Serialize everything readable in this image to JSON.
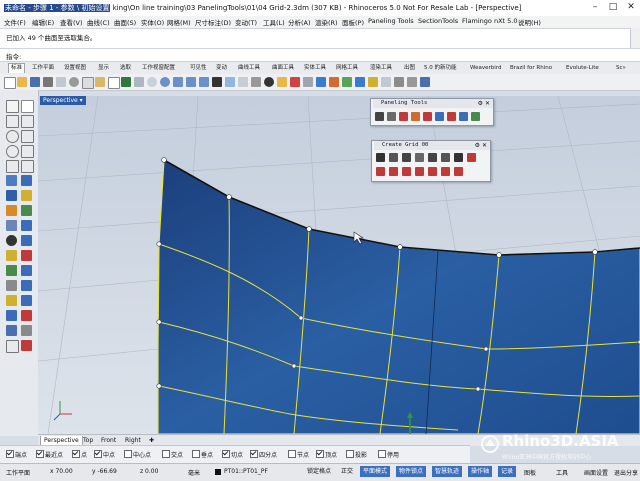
{
  "titlebar": {
    "text_highlight": "未命名 - 步骤 1 - 参数 \\ 初始设置",
    "text": "king\\On line training\\03 PanelingTools\\01\\04 Grid-2.3dm (307 KB) - Rhinoceros 5.0 Not For Resale Lab - [Perspective]"
  },
  "menu": [
    "文件(F)",
    "编辑(E)",
    "查看(V)",
    "曲线(C)",
    "曲面(S)",
    "实体(O)",
    "网格(M)",
    "尺寸标注(D)",
    "变动(T)",
    "工具(L)",
    "分析(A)",
    "渲染(R)",
    "面板(P)",
    "Paneling Tools",
    "SectionTools",
    "Flamingo nXt 5.0",
    "说明(H)"
  ],
  "command": {
    "history": "已加入 49 个曲面至选取集合。",
    "prompt_label": "指令:"
  },
  "toolbar_tabs": [
    "标准",
    "工作平面",
    "设置视图",
    "显示",
    "选取",
    "工作视窗配置",
    "可见性",
    "变动",
    "曲线工具",
    "曲面工具",
    "实体工具",
    "网格工具",
    "渲染工具",
    "出图",
    "5.0 的新功能",
    "Weaverbird",
    "Brazil for Rhino",
    "Evolute-Lite",
    "Sc»"
  ],
  "viewport": {
    "label": "Perspective"
  },
  "panels": {
    "paneling_tools": {
      "title": "Paneling Tools"
    },
    "create_grid": {
      "title": "Create Grid 00"
    }
  },
  "viewport_tabs": [
    "Perspective",
    "Top",
    "Front",
    "Right"
  ],
  "osnaps": [
    {
      "label": "端点",
      "checked": true
    },
    {
      "label": "最近点",
      "checked": true
    },
    {
      "label": "点",
      "checked": true
    },
    {
      "label": "中点",
      "checked": true
    },
    {
      "label": "中心点",
      "checked": false
    },
    {
      "label": "交点",
      "checked": false
    },
    {
      "label": "垂点",
      "checked": false
    },
    {
      "label": "切点",
      "checked": true
    },
    {
      "label": "四分点",
      "checked": true
    },
    {
      "label": "节点",
      "checked": false
    },
    {
      "label": "顶点",
      "checked": true
    },
    {
      "label": "投影",
      "checked": false
    },
    {
      "label": "停用",
      "checked": false
    }
  ],
  "status": {
    "cplane": "工作平面",
    "x": "x 70.00",
    "y": "y -66.69",
    "z": "z 0.00",
    "unit": "毫米",
    "layer": "PT01::PT01_PF",
    "buttons": [
      {
        "label": "锁定格点",
        "on": false
      },
      {
        "label": "正交",
        "on": false
      },
      {
        "label": "平面模式",
        "on": true
      },
      {
        "label": "物件锁点",
        "on": true
      },
      {
        "label": "智慧轨迹",
        "on": true
      },
      {
        "label": "操作轴",
        "on": true
      },
      {
        "label": "记录",
        "on": true
      }
    ],
    "right": [
      "图板",
      "工具",
      "画面设置",
      "退出分享"
    ]
  },
  "watermark": {
    "brand": "Rhino3D.ASIA",
    "tagline": "Rhino亚洲中国官方授权培训中心"
  },
  "colors": {
    "surface": "#1f4f8f",
    "grid": "#e8e23a",
    "viewport_bg": "#c9d3e0",
    "accent": "#3d6fbf"
  }
}
